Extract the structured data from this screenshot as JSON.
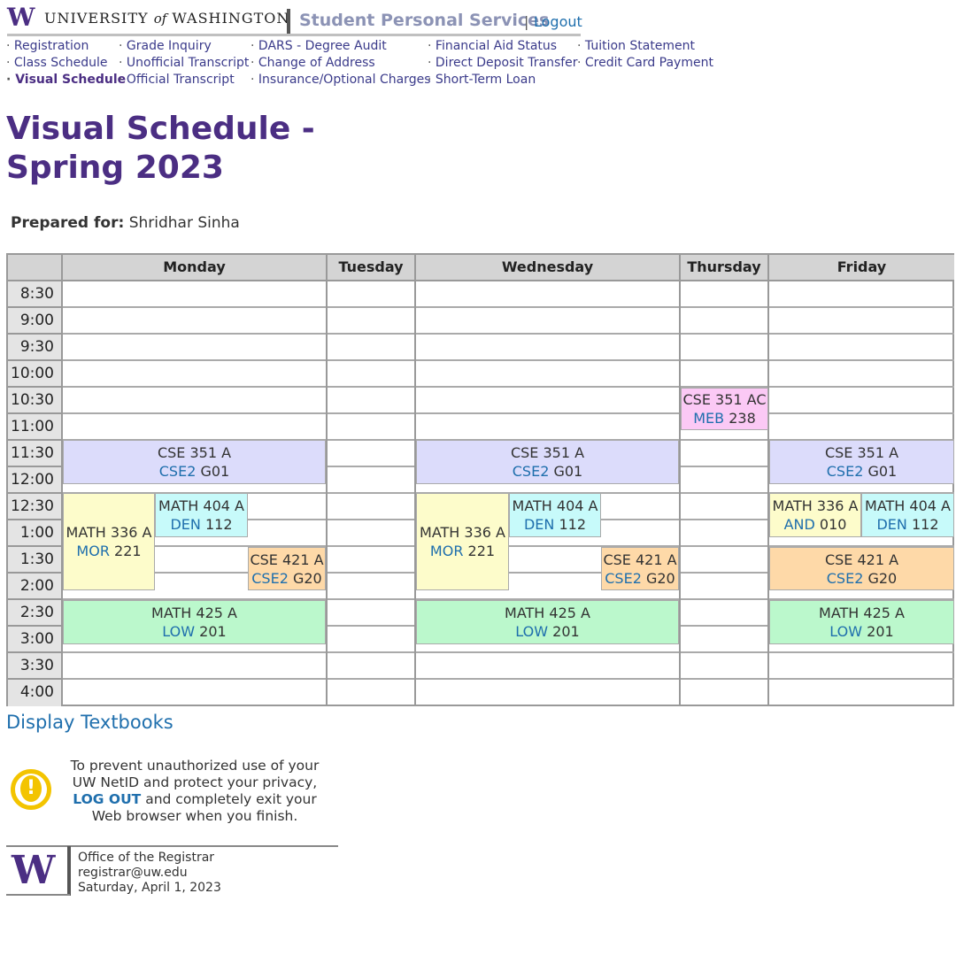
{
  "header": {
    "logo_letter": "W",
    "wordmark_pre": "UNIVERSITY",
    "wordmark_of": "of",
    "wordmark_post": "WASHINGTON",
    "service_title": "Student Personal Services",
    "separator": "|",
    "logout": "Logout"
  },
  "nav": {
    "col1": [
      "Registration",
      "Class Schedule",
      "Visual Schedule"
    ],
    "col2": [
      "Grade Inquiry",
      "Unofficial Transcript",
      "Official Transcript"
    ],
    "col3": [
      "DARS - Degree Audit",
      "Change of Address",
      "Insurance/Optional Charges"
    ],
    "col4": [
      "Financial Aid Status",
      "Direct Deposit Transfer",
      "Short-Term Loan"
    ],
    "col5": [
      "Tuition Statement",
      "Credit Card Payment"
    ],
    "active": "Visual Schedule"
  },
  "page": {
    "title": "Visual Schedule - Spring 2023",
    "prepared_label": "Prepared for:",
    "prepared_name": "Shridhar Sinha"
  },
  "schedule": {
    "days": [
      "Monday",
      "Tuesday",
      "Wednesday",
      "Thursday",
      "Friday"
    ],
    "times": [
      "8:30",
      "9:00",
      "9:30",
      "10:00",
      "10:30",
      "11:00",
      "11:30",
      "12:00",
      "12:30",
      "1:00",
      "1:30",
      "2:00",
      "2:30",
      "3:00",
      "3:30",
      "4:00"
    ],
    "courses": {
      "cse351": {
        "name": "CSE 351 A",
        "bldg": "CSE2",
        "room": "G01"
      },
      "math336_mor": {
        "name": "MATH 336 A",
        "bldg": "MOR",
        "room": "221"
      },
      "math336_and": {
        "name": "MATH 336 A",
        "bldg": "AND",
        "room": "010"
      },
      "math404": {
        "name": "MATH 404 A",
        "bldg": "DEN",
        "room": "112"
      },
      "cse421": {
        "name": "CSE 421 A",
        "bldg": "CSE2",
        "room": "G20"
      },
      "math425": {
        "name": "MATH 425 A",
        "bldg": "LOW",
        "room": "201"
      },
      "cse351ac": {
        "name": "CSE 351 AC",
        "bldg": "MEB",
        "room": "238"
      }
    },
    "colors": {
      "cse351": "#dcdcfb",
      "math336": "#fdfccb",
      "math404": "#c7fafa",
      "cse421": "#fed9a8",
      "math425": "#bbf8cc",
      "cse351ac": "#fbc9f5"
    }
  },
  "footer": {
    "textbooks": "Display Textbooks",
    "warn_icon": "exclamation-circle-icon",
    "warn_pre": "To prevent unauthorized use of your UW NetID and protect your privacy,",
    "warn_logout": "LOG OUT",
    "warn_post": "and completely exit your Web browser when you finish.",
    "office": "Office of the Registrar",
    "email": "registrar@uw.edu",
    "date": "Saturday, April 1, 2023",
    "logo_letter": "W"
  }
}
